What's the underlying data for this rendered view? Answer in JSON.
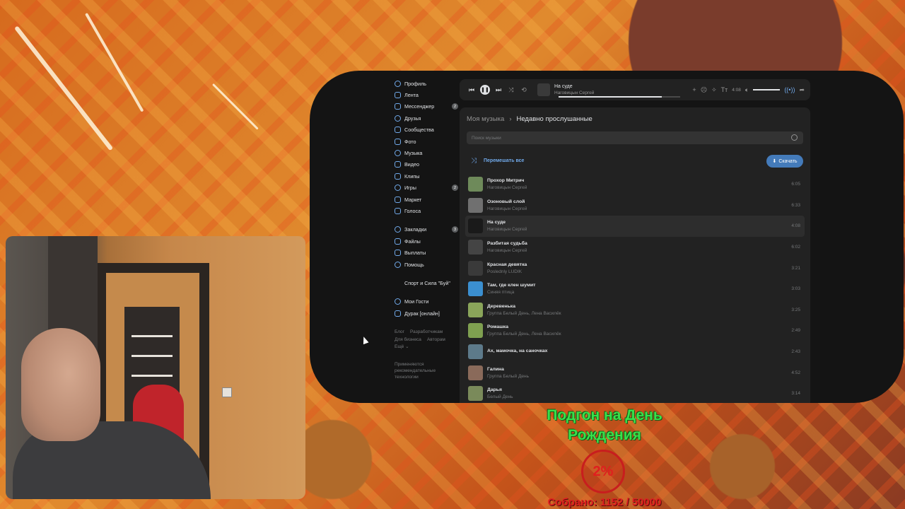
{
  "sidebar": {
    "items": [
      {
        "label": "Профиль",
        "icon": "profile-icon"
      },
      {
        "label": "Лента",
        "icon": "news-icon"
      },
      {
        "label": "Мессенджер",
        "icon": "messenger-icon",
        "badge": "2"
      },
      {
        "label": "Друзья",
        "icon": "friends-icon"
      },
      {
        "label": "Сообщества",
        "icon": "communities-icon"
      },
      {
        "label": "Фото",
        "icon": "photo-icon"
      },
      {
        "label": "Музыка",
        "icon": "music-icon"
      },
      {
        "label": "Видео",
        "icon": "video-icon"
      },
      {
        "label": "Клипы",
        "icon": "clips-icon"
      },
      {
        "label": "Игры",
        "icon": "games-icon",
        "badge": "2"
      },
      {
        "label": "Маркет",
        "icon": "market-icon"
      },
      {
        "label": "Голоса",
        "icon": "votes-icon"
      }
    ],
    "items2": [
      {
        "label": "Закладки",
        "icon": "bookmarks-icon",
        "badge": "3"
      },
      {
        "label": "Файлы",
        "icon": "files-icon"
      },
      {
        "label": "Выплаты",
        "icon": "payments-icon"
      },
      {
        "label": "Помощь",
        "icon": "help-icon"
      }
    ],
    "group": "Спорт и Сила \"Буй\"",
    "items3": [
      {
        "label": "Мои Гости",
        "icon": "guests-icon"
      },
      {
        "label": "Дурак [онлайн]",
        "icon": "game-icon"
      }
    ],
    "footer": {
      "links": [
        "Блог",
        "Разработчикам",
        "Для бизнеса",
        "Авторам",
        "Ещё ⌄"
      ],
      "note": "Применяются рекомендательные технологии"
    }
  },
  "player": {
    "title": "На суде",
    "artist": "Наговицын Сергей",
    "time": "4:08",
    "progress": 0.85
  },
  "music": {
    "breadcrumb_root": "Моя музыка",
    "breadcrumb_current": "Недавно прослушанные",
    "search_placeholder": "Поиск музыки",
    "shuffle_label": "Перемешать все",
    "download_label": "Скачать",
    "tracks": [
      {
        "title": "Прохор Митрич",
        "artist": "Наговицын Сергей",
        "duration": "6:05",
        "cover": "#6e8a5a"
      },
      {
        "title": "Озоновый слой",
        "artist": "Наговицын Сергей",
        "duration": "6:33",
        "cover": "#707070"
      },
      {
        "title": "На суде",
        "artist": "Наговицын Сергей",
        "duration": "4:08",
        "cover": "#1a1a1a"
      },
      {
        "title": "Разбитая судьба",
        "artist": "Наговицын Сергей",
        "duration": "6:02",
        "cover": "#444444"
      },
      {
        "title": "Красная девятка",
        "artist": "Poslednly LUDIK",
        "duration": "3:21",
        "cover": "#3a3a3a"
      },
      {
        "title": "Там, где клен шумит",
        "artist": "Синяя птица",
        "duration": "3:03",
        "cover": "#3b8fd0"
      },
      {
        "title": "Деревенька",
        "artist": "Группа Белый День, Лена Василёк",
        "duration": "3:25",
        "cover": "#8aa55a"
      },
      {
        "title": "Ромашка",
        "artist": "Группа Белый День, Лена Василёк",
        "duration": "2:49",
        "cover": "#7fa050"
      },
      {
        "title": "Ах, мамочка, на саночках",
        "artist": "",
        "duration": "2:43",
        "cover": "#5d7a8a"
      },
      {
        "title": "Галина",
        "artist": "Группа Белый День",
        "duration": "4:52",
        "cover": "#8a6a5a"
      },
      {
        "title": "Дарья",
        "artist": "Белый День",
        "duration": "3:14",
        "cover": "#7a8a5a"
      }
    ]
  },
  "donation": {
    "title": "Подгон на День Рождения",
    "percent": "2%",
    "amount": "Собрано: 1152 / 50000"
  }
}
